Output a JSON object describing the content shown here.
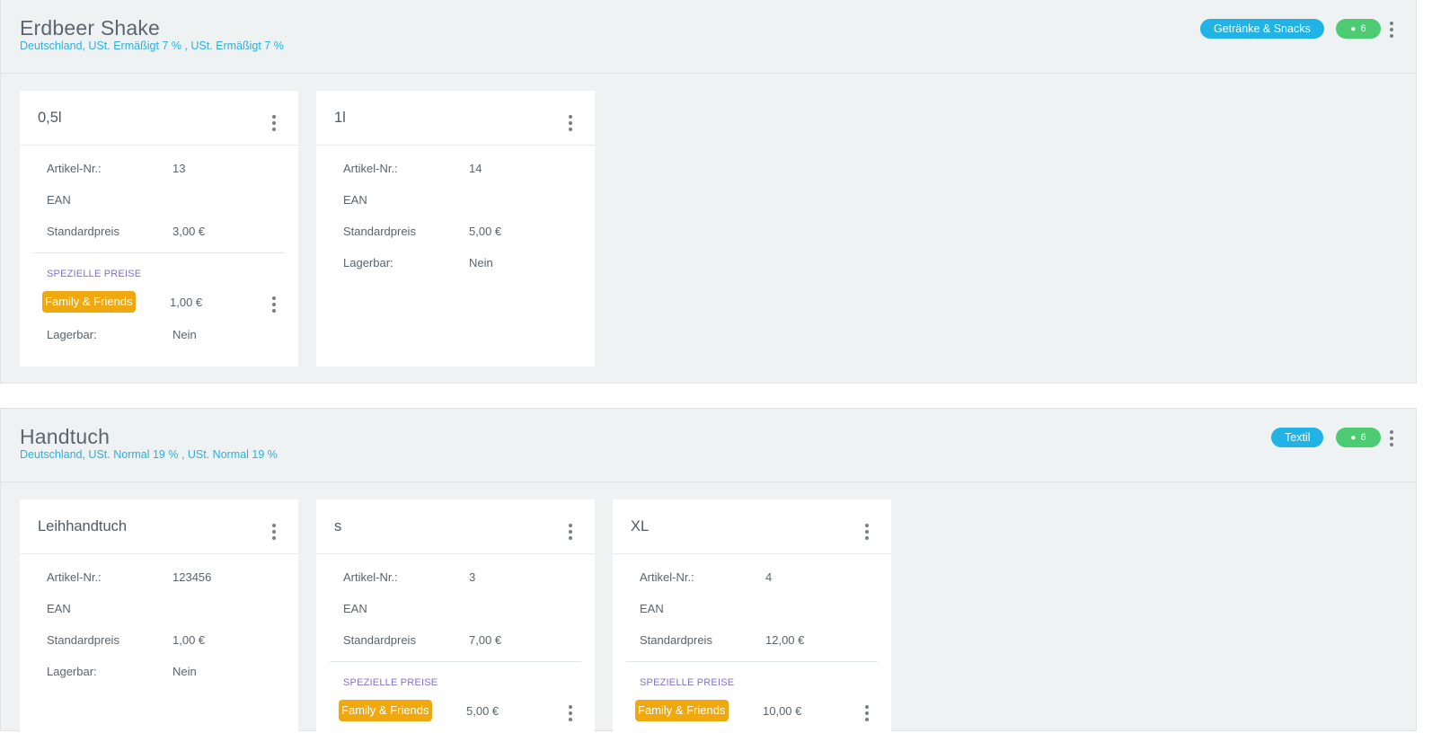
{
  "products": [
    {
      "title": "Erdbeer Shake",
      "subtitle": "Deutschland, USt. Ermäßigt 7 % , USt. Ermäßigt 7 %",
      "category": "Getränke & Snacks",
      "locations": "6",
      "variants": [
        {
          "name": "0,5l",
          "artikel_label": "Artikel-Nr.:",
          "artikel": "13",
          "ean_label": "EAN",
          "ean": "",
          "preis_label": "Standardpreis",
          "preis": "3,00 €",
          "special_label": "SPEZIELLE PREISE",
          "special_name": "Family & Friends",
          "special_price": "1,00 €",
          "lager_label": "Lagerbar:",
          "lager": "Nein"
        },
        {
          "name": "1l",
          "artikel_label": "Artikel-Nr.:",
          "artikel": "14",
          "ean_label": "EAN",
          "ean": "",
          "preis_label": "Standardpreis",
          "preis": "5,00 €",
          "lager_label": "Lagerbar:",
          "lager": "Nein"
        }
      ]
    },
    {
      "title": "Handtuch",
      "subtitle": "Deutschland, USt. Normal 19 % , USt. Normal 19 %",
      "category": "Textil",
      "locations": "6",
      "variants": [
        {
          "name": "Leihhandtuch",
          "artikel_label": "Artikel-Nr.:",
          "artikel": "123456",
          "ean_label": "EAN",
          "ean": "",
          "preis_label": "Standardpreis",
          "preis": "1,00 €",
          "lager_label": "Lagerbar:",
          "lager": "Nein"
        },
        {
          "name": "s",
          "artikel_label": "Artikel-Nr.:",
          "artikel": "3",
          "ean_label": "EAN",
          "ean": "",
          "preis_label": "Standardpreis",
          "preis": "7,00 €",
          "special_label": "SPEZIELLE PREISE",
          "special_name": "Family & Friends",
          "special_price": "5,00 €"
        },
        {
          "name": "XL",
          "artikel_label": "Artikel-Nr.:",
          "artikel": "4",
          "ean_label": "EAN",
          "ean": "",
          "preis_label": "Standardpreis",
          "preis": "12,00 €",
          "special_label": "SPEZIELLE PREISE",
          "special_name": "Family & Friends",
          "special_price": "10,00 €"
        }
      ]
    }
  ],
  "icons": {
    "location": "map-pin-icon",
    "menu": "kebab-menu-icon"
  },
  "colors": {
    "category_badge": "#22b3e6",
    "location_badge": "#4dcb72",
    "special_badge": "#f0a80f",
    "subtitle": "#2ab1df",
    "special_label": "#7f71c8"
  }
}
